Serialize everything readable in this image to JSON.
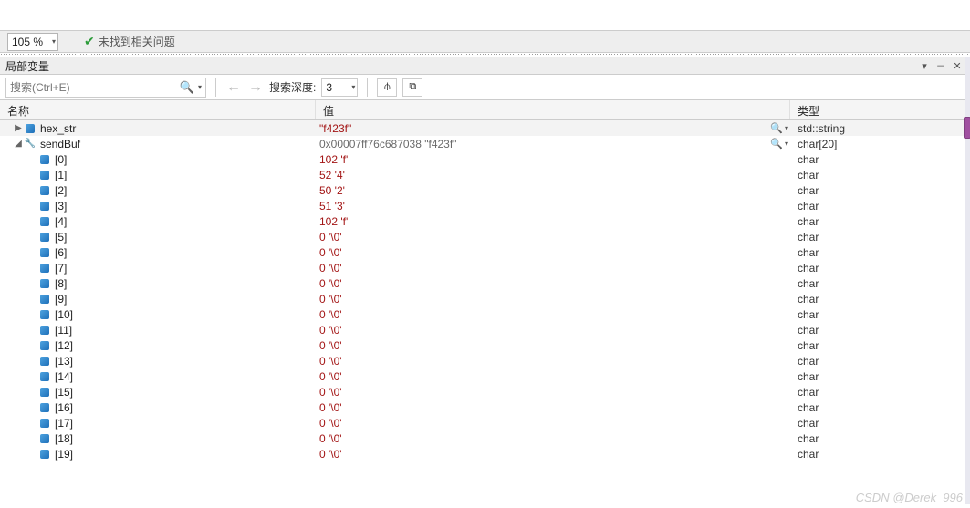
{
  "zoom": "105 %",
  "issues_text": "未找到相关问题",
  "panel_title": "局部变量",
  "search_placeholder": "搜索(Ctrl+E)",
  "depth_label": "搜索深度:",
  "depth_value": "3",
  "columns": {
    "name": "名称",
    "value": "值",
    "type": "类型"
  },
  "rows": [
    {
      "depth": 0,
      "expander": "▶",
      "icon": "cube",
      "name": "hex_str",
      "value": "\"f423f\"",
      "valcls": "",
      "icons": true,
      "type": "std::string",
      "shaded": true
    },
    {
      "depth": 0,
      "expander": "◢",
      "icon": "wrench",
      "name": "sendBuf",
      "value": "0x00007ff76c687038 \"f423f\"",
      "valcls": "addr",
      "icons": true,
      "type": "char[20]",
      "shaded": false
    },
    {
      "depth": 1,
      "expander": "",
      "icon": "cube",
      "name": "[0]",
      "value": "102 'f'",
      "valcls": "",
      "icons": false,
      "type": "char",
      "shaded": false
    },
    {
      "depth": 1,
      "expander": "",
      "icon": "cube",
      "name": "[1]",
      "value": "52 '4'",
      "valcls": "",
      "icons": false,
      "type": "char",
      "shaded": false
    },
    {
      "depth": 1,
      "expander": "",
      "icon": "cube",
      "name": "[2]",
      "value": "50 '2'",
      "valcls": "",
      "icons": false,
      "type": "char",
      "shaded": false
    },
    {
      "depth": 1,
      "expander": "",
      "icon": "cube",
      "name": "[3]",
      "value": "51 '3'",
      "valcls": "",
      "icons": false,
      "type": "char",
      "shaded": false
    },
    {
      "depth": 1,
      "expander": "",
      "icon": "cube",
      "name": "[4]",
      "value": "102 'f'",
      "valcls": "",
      "icons": false,
      "type": "char",
      "shaded": false
    },
    {
      "depth": 1,
      "expander": "",
      "icon": "cube",
      "name": "[5]",
      "value": "0 '\\0'",
      "valcls": "",
      "icons": false,
      "type": "char",
      "shaded": false
    },
    {
      "depth": 1,
      "expander": "",
      "icon": "cube",
      "name": "[6]",
      "value": "0 '\\0'",
      "valcls": "",
      "icons": false,
      "type": "char",
      "shaded": false
    },
    {
      "depth": 1,
      "expander": "",
      "icon": "cube",
      "name": "[7]",
      "value": "0 '\\0'",
      "valcls": "",
      "icons": false,
      "type": "char",
      "shaded": false
    },
    {
      "depth": 1,
      "expander": "",
      "icon": "cube",
      "name": "[8]",
      "value": "0 '\\0'",
      "valcls": "",
      "icons": false,
      "type": "char",
      "shaded": false
    },
    {
      "depth": 1,
      "expander": "",
      "icon": "cube",
      "name": "[9]",
      "value": "0 '\\0'",
      "valcls": "",
      "icons": false,
      "type": "char",
      "shaded": false
    },
    {
      "depth": 1,
      "expander": "",
      "icon": "cube",
      "name": "[10]",
      "value": "0 '\\0'",
      "valcls": "",
      "icons": false,
      "type": "char",
      "shaded": false
    },
    {
      "depth": 1,
      "expander": "",
      "icon": "cube",
      "name": "[11]",
      "value": "0 '\\0'",
      "valcls": "",
      "icons": false,
      "type": "char",
      "shaded": false
    },
    {
      "depth": 1,
      "expander": "",
      "icon": "cube",
      "name": "[12]",
      "value": "0 '\\0'",
      "valcls": "",
      "icons": false,
      "type": "char",
      "shaded": false
    },
    {
      "depth": 1,
      "expander": "",
      "icon": "cube",
      "name": "[13]",
      "value": "0 '\\0'",
      "valcls": "",
      "icons": false,
      "type": "char",
      "shaded": false
    },
    {
      "depth": 1,
      "expander": "",
      "icon": "cube",
      "name": "[14]",
      "value": "0 '\\0'",
      "valcls": "",
      "icons": false,
      "type": "char",
      "shaded": false
    },
    {
      "depth": 1,
      "expander": "",
      "icon": "cube",
      "name": "[15]",
      "value": "0 '\\0'",
      "valcls": "",
      "icons": false,
      "type": "char",
      "shaded": false
    },
    {
      "depth": 1,
      "expander": "",
      "icon": "cube",
      "name": "[16]",
      "value": "0 '\\0'",
      "valcls": "",
      "icons": false,
      "type": "char",
      "shaded": false
    },
    {
      "depth": 1,
      "expander": "",
      "icon": "cube",
      "name": "[17]",
      "value": "0 '\\0'",
      "valcls": "",
      "icons": false,
      "type": "char",
      "shaded": false
    },
    {
      "depth": 1,
      "expander": "",
      "icon": "cube",
      "name": "[18]",
      "value": "0 '\\0'",
      "valcls": "",
      "icons": false,
      "type": "char",
      "shaded": false
    },
    {
      "depth": 1,
      "expander": "",
      "icon": "cube",
      "name": "[19]",
      "value": "0 '\\0'",
      "valcls": "",
      "icons": false,
      "type": "char",
      "shaded": false
    }
  ],
  "watermark": "CSDN @Derek_996"
}
